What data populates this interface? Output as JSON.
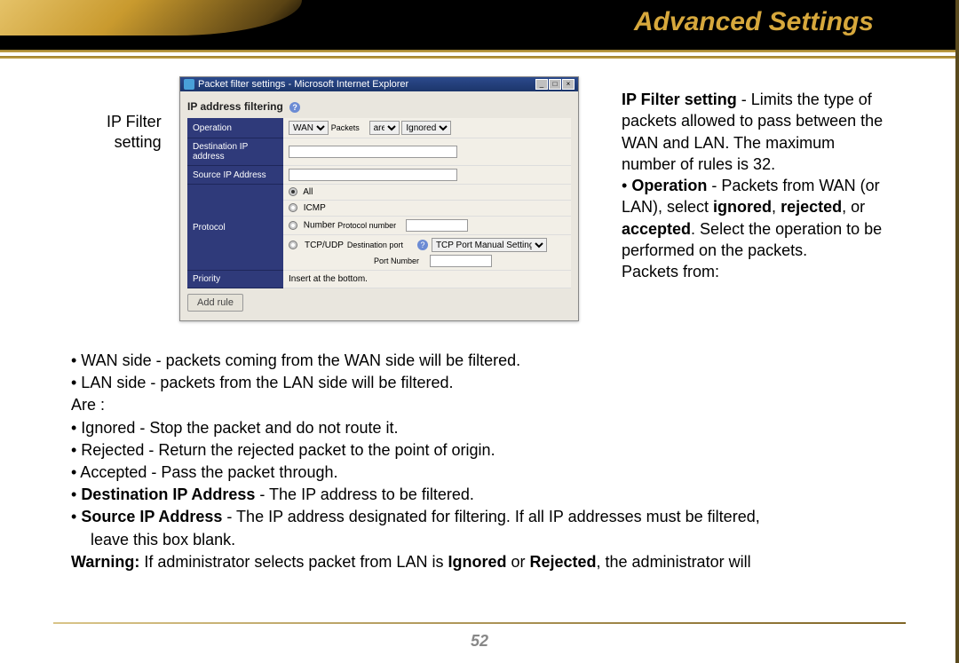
{
  "header": {
    "title": "Advanced Settings"
  },
  "caption_left": {
    "line1": "IP Filter",
    "line2": "setting"
  },
  "browser": {
    "title": "Packet filter settings - Microsoft Internet Explorer",
    "section_title": "IP address filtering",
    "help": "?",
    "rows": {
      "operation_label": "Operation",
      "op_select1": "WAN",
      "op_between": "Packets",
      "op_select2": "are",
      "op_select3": "Ignored",
      "dest_ip_label": "Destination IP address",
      "src_ip_label": "Source IP Address",
      "protocol_label": "Protocol",
      "proto_all": "All",
      "proto_icmp": "ICMP",
      "proto_number": "Number",
      "proto_number_label": "Protocol number",
      "proto_tcpudp": "TCP/UDP",
      "dest_port_label": "Destination port",
      "dest_port_help": "?",
      "tcp_port_setting": "TCP Port Manual Setting",
      "port_number_label": "Port Number",
      "priority_label": "Priority",
      "priority_text": "Insert at the bottom."
    },
    "add_button": "Add rule"
  },
  "desc": {
    "heading": "IP Filter setting",
    "p1_rest": " - Limits the type of packets allowed to pass between the WAN and LAN. The maximum number of rules is 32.",
    "bullet": "• ",
    "operation_b": "Operation",
    "p2_mid": " - Packets from WAN (or LAN), select ",
    "ignored": "ignored",
    "rejected": "rejected",
    "accepted": "accepted",
    "p2_tail": ".  Select the operation to be performed on the packets.",
    "p2_last": "Packets from:"
  },
  "body": {
    "l1": "• WAN side - packets coming from the WAN side will be filtered.",
    "l2": "• LAN side - packets from the LAN side will be filtered.",
    "l3": "Are :",
    "l4": "• Ignored - Stop the packet and do not route it.",
    "l5": "• Rejected - Return the rejected packet to the point of origin.",
    "l6": "•  Accepted - Pass the packet through.",
    "l7a": "• ",
    "l7b": "Destination IP Address",
    "l7c": " - The IP address to be filtered.",
    "l8a": "• ",
    "l8b": "Source IP Address",
    "l8c": " - The IP address designated for filtering. If all IP addresses must be filtered,",
    "l8_indent": "leave this box blank.",
    "l9a": "Warning:",
    "l9b": " If administrator selects packet from LAN is ",
    "l9c": "Ignored",
    "l9d": " or ",
    "l9e": "Rejected",
    "l9f": ", the administrator will"
  },
  "page_number": "52"
}
